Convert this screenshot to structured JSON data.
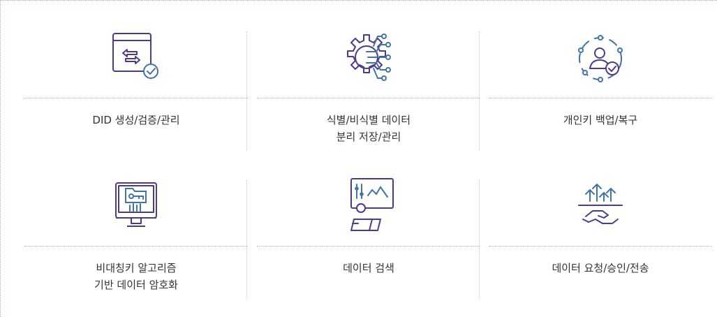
{
  "features": [
    {
      "icon": "transfer-check-icon",
      "lines": [
        "DID 생성/검증/관리"
      ]
    },
    {
      "icon": "gear-circuit-icon",
      "lines": [
        "식별/비식별 데이터",
        "분리 저장/관리"
      ]
    },
    {
      "icon": "user-check-icon",
      "lines": [
        "개인키 백업/복구"
      ]
    },
    {
      "icon": "monitor-key-icon",
      "lines": [
        "비대칭키 알고리즘",
        "기반 데이터 암호화"
      ]
    },
    {
      "icon": "analytics-person-icon",
      "lines": [
        "데이터 검색"
      ]
    },
    {
      "icon": "handshake-arrows-icon",
      "lines": [
        "데이터 요청/승인/전송"
      ]
    }
  ],
  "colors": {
    "purple": "#4b3a8e",
    "blue": "#3f74a8",
    "text": "#333333",
    "divider": "#a7b4c4"
  }
}
